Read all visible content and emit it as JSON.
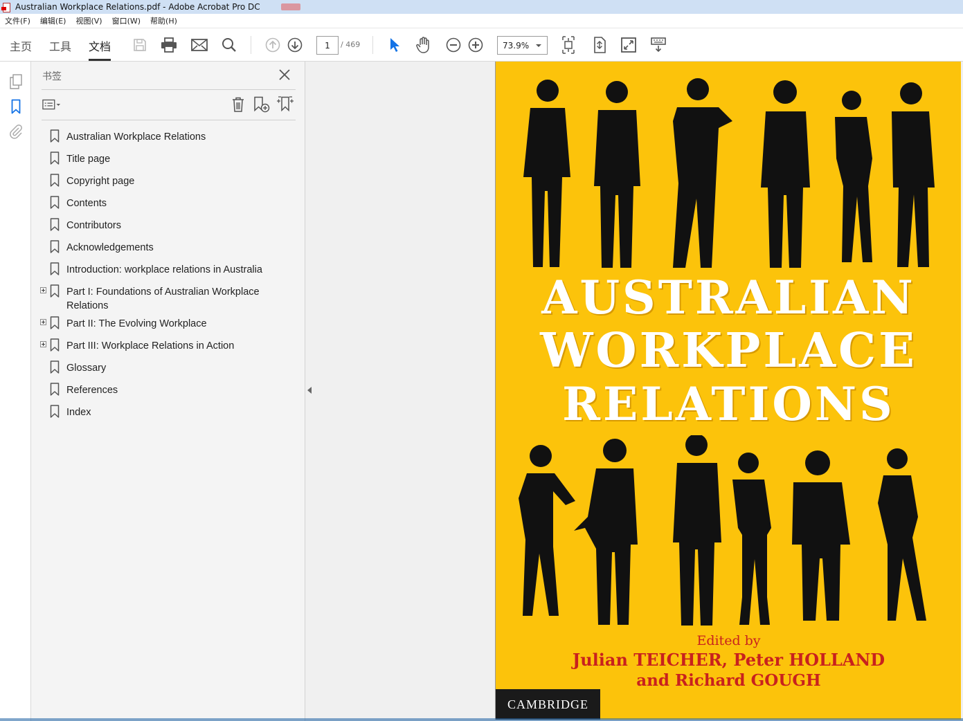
{
  "window": {
    "title": "Australian Workplace Relations.pdf - Adobe Acrobat Pro DC"
  },
  "menu": [
    "文件(F)",
    "编辑(E)",
    "视图(V)",
    "窗口(W)",
    "帮助(H)"
  ],
  "toolbar": {
    "tabs": [
      "主页",
      "工具",
      "文档"
    ],
    "page_current": "1",
    "page_total": "/ 469",
    "zoom": "73.9%"
  },
  "bookmarks_panel": {
    "title": "书签",
    "items": [
      {
        "label": "Australian Workplace Relations",
        "expandable": false
      },
      {
        "label": "Title page",
        "expandable": false
      },
      {
        "label": "Copyright page",
        "expandable": false
      },
      {
        "label": "Contents",
        "expandable": false
      },
      {
        "label": "Contributors",
        "expandable": false
      },
      {
        "label": "Acknowledgements",
        "expandable": false
      },
      {
        "label": "Introduction: workplace relations in Australia",
        "expandable": false
      },
      {
        "label": "Part I: Foundations of Australian Workplace Relations",
        "expandable": true
      },
      {
        "label": "Part II: The Evolving Workplace",
        "expandable": true
      },
      {
        "label": "Part III: Workplace Relations in Action",
        "expandable": true
      },
      {
        "label": "Glossary",
        "expandable": false
      },
      {
        "label": "References",
        "expandable": false
      },
      {
        "label": "Index",
        "expandable": false
      }
    ]
  },
  "cover": {
    "title_lines": [
      "AUSTRALIAN",
      "WORKPLACE",
      "RELATIONS"
    ],
    "edited_by": "Edited by",
    "editors_line1": "Julian TEICHER, Peter HOLLAND",
    "editors_line2": "and Richard GOUGH",
    "publisher": "CAMBRIDGE",
    "background_color": "#fcc30b",
    "editor_color": "#c8211e"
  }
}
